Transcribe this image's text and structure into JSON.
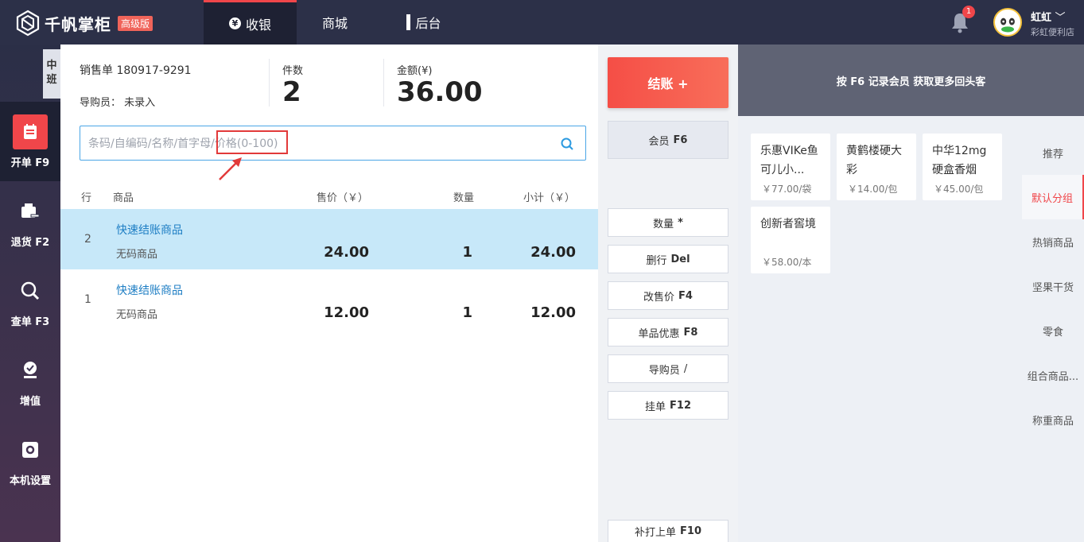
{
  "header": {
    "logo_text": "千帆掌柜",
    "edition_badge": "高级版",
    "tabs": [
      {
        "label": "收银",
        "icon": "yen-circle-icon"
      },
      {
        "label": "商城",
        "icon": ""
      },
      {
        "label": "后台",
        "icon": "grid-icon"
      }
    ],
    "notification_count": "1",
    "user_name": "虹虹",
    "store_name": "彩虹便利店"
  },
  "sidebar": {
    "shift_label": "中班",
    "items": [
      {
        "label": "开单 F9",
        "icon": "order-icon"
      },
      {
        "label": "退货 F2",
        "icon": "return-icon"
      },
      {
        "label": "查单 F3",
        "icon": "search-icon"
      },
      {
        "label": "增值",
        "icon": "value-added-icon"
      },
      {
        "label": "本机设置",
        "icon": "settings-icon"
      }
    ]
  },
  "order": {
    "order_label": "销售单 180917-9291",
    "guide_label": "导购员：",
    "guide_value": "未录入",
    "count_label": "件数",
    "count_value": "2",
    "amount_label": "金额(¥)",
    "amount_value": "36.00"
  },
  "search": {
    "placeholder": "条码/自编码/名称/首字母/价格(0-100)"
  },
  "table": {
    "headers": [
      "行",
      "商品",
      "售价（￥）",
      "数量",
      "小计（￥）"
    ],
    "rows": [
      {
        "idx": "2",
        "name": "快速结账商品",
        "sub": "无码商品",
        "price": "24.00",
        "qty": "1",
        "subtotal": "24.00"
      },
      {
        "idx": "1",
        "name": "快速结账商品",
        "sub": "无码商品",
        "price": "12.00",
        "qty": "1",
        "subtotal": "12.00"
      }
    ]
  },
  "actions": {
    "checkout": "结账 +",
    "member": {
      "label": "会员",
      "key": "F6"
    },
    "buttons": [
      {
        "label": "数量",
        "key": "*"
      },
      {
        "label": "删行",
        "key": "Del"
      },
      {
        "label": "改售价",
        "key": "F4"
      },
      {
        "label": "单品优惠",
        "key": "F8"
      },
      {
        "label": "导购员",
        "key": "/"
      },
      {
        "label": "挂单",
        "key": "F12"
      }
    ],
    "reprint": {
      "label": "补打上单",
      "key": "F10"
    }
  },
  "right": {
    "promo": "按 F6 记录会员 获取更多回头客",
    "products": [
      {
        "name": "乐惠VIKe鱼可儿小...",
        "price": "￥77.00/袋"
      },
      {
        "name": "黄鹤楼硬大彩",
        "price": "￥14.00/包"
      },
      {
        "name": "中华12mg硬盒香烟",
        "price": "￥45.00/包"
      },
      {
        "name": "创新者窖境",
        "price": "￥58.00/本"
      }
    ],
    "categories": [
      "推荐",
      "默认分组",
      "热销商品",
      "坚果干货",
      "零食",
      "组合商品...",
      "称重商品"
    ],
    "active_category": "默认分组"
  },
  "colors": {
    "topbar": "#2c3048",
    "accent_red": "#f0464a",
    "selected_row": "#c7e8f9",
    "link_blue": "#1e7ec4"
  }
}
